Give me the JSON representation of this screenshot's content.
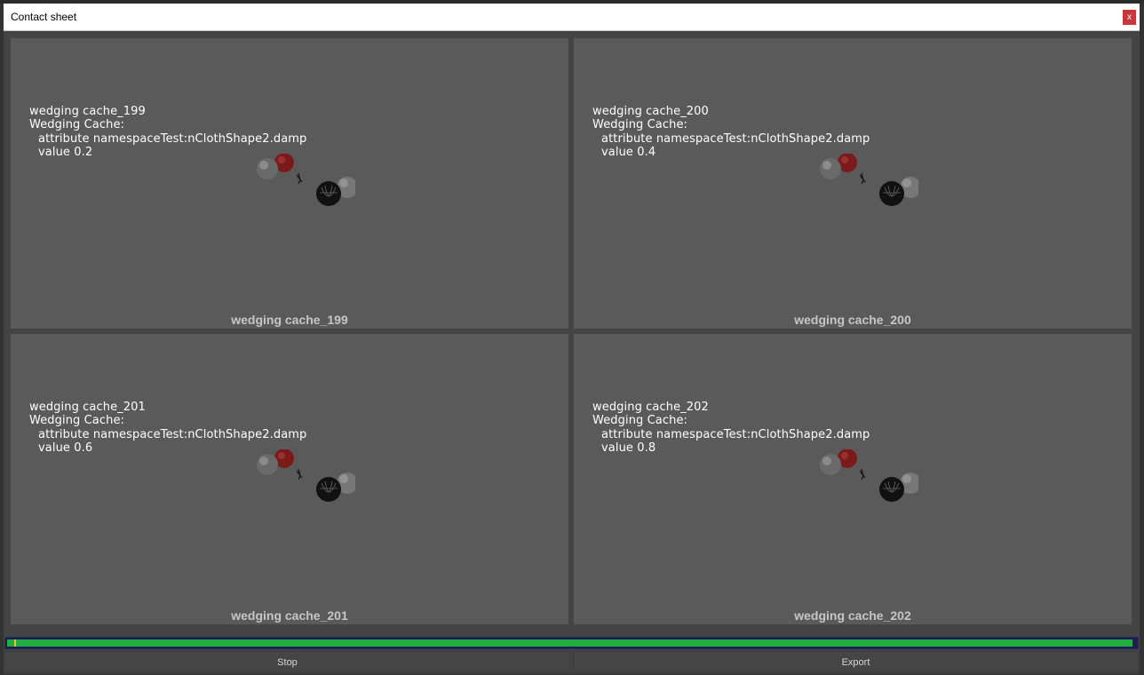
{
  "window": {
    "title": "Contact sheet",
    "close_label": "x"
  },
  "cells": [
    {
      "overlay": [
        "wedging cache_199",
        "Wedging Cache:",
        "attribute namespaceTest:nClothShape2.damp",
        "value 0.2"
      ],
      "caption": "wedging cache_199"
    },
    {
      "overlay": [
        "wedging cache_200",
        "Wedging Cache:",
        "attribute namespaceTest:nClothShape2.damp",
        "value 0.4"
      ],
      "caption": "wedging cache_200"
    },
    {
      "overlay": [
        "wedging cache_201",
        "Wedging Cache:",
        "attribute namespaceTest:nClothShape2.damp",
        "value 0.6"
      ],
      "caption": "wedging cache_201"
    },
    {
      "overlay": [
        "wedging cache_202",
        "Wedging Cache:",
        "attribute namespaceTest:nClothShape2.damp",
        "value 0.8"
      ],
      "caption": "wedging cache_202"
    }
  ],
  "progress": {
    "value_fraction": 0.997
  },
  "buttons": {
    "stop_label": "Stop",
    "export_label": "Export"
  },
  "colors": {
    "accent_progress": "#1fae3f",
    "close_button": "#c8373c",
    "viewport_bg": "#5a5a5a"
  }
}
